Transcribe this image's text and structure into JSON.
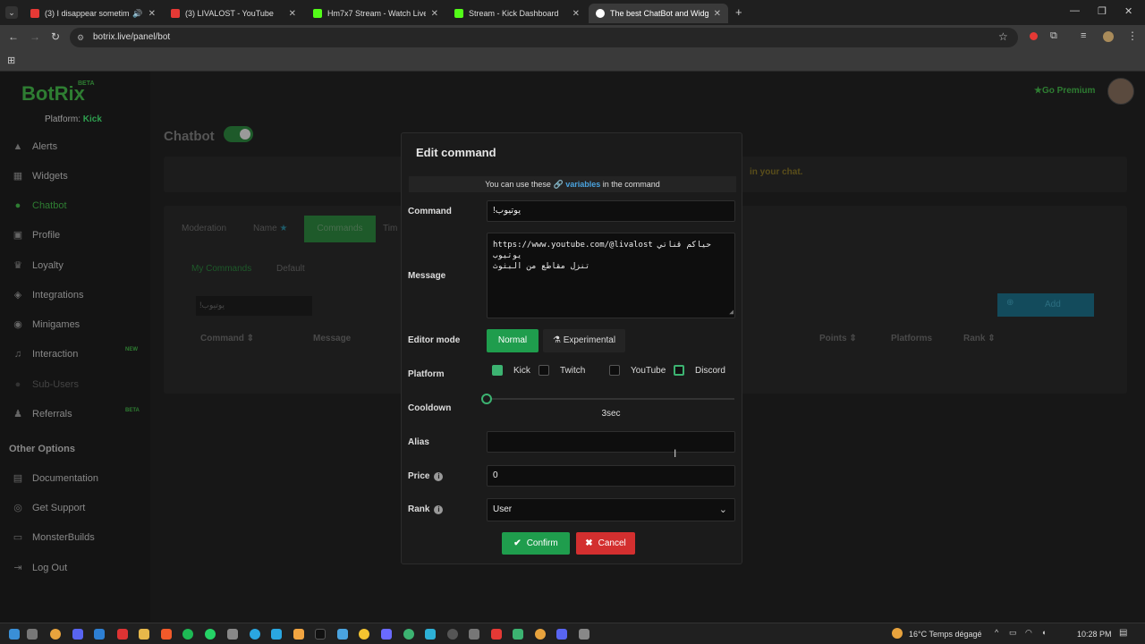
{
  "browser": {
    "tabs": [
      {
        "title": "(3) I disappear sometimes,",
        "color": "#e53935"
      },
      {
        "title": "(3) LIVALOST - YouTube",
        "color": "#e53935"
      },
      {
        "title": "Hm7x7 Stream - Watch Live on",
        "color": "#53fc18"
      },
      {
        "title": "Stream - Kick Dashboard",
        "color": "#53fc18"
      },
      {
        "title": "The best ChatBot and Widgets",
        "color": "#ffffff"
      }
    ],
    "url": "botrix.live/panel/bot"
  },
  "sidebar": {
    "logo": "BotRix",
    "beta": "BETA",
    "platform_label": "Platform:",
    "platform_value": "Kick",
    "items": [
      {
        "label": "Alerts",
        "icon": "warning-icon"
      },
      {
        "label": "Widgets",
        "icon": "grid-icon"
      },
      {
        "label": "Chatbot",
        "icon": "robot-icon"
      },
      {
        "label": "Profile",
        "icon": "profile-icon"
      },
      {
        "label": "Loyalty",
        "icon": "trophy-icon"
      },
      {
        "label": "Integrations",
        "icon": "puzzle-icon"
      },
      {
        "label": "Minigames",
        "icon": "gamepad-icon"
      },
      {
        "label": "Interaction",
        "icon": "music-icon"
      },
      {
        "label": "Sub-Users",
        "icon": "users-icon"
      },
      {
        "label": "Referrals",
        "icon": "referral-icon"
      }
    ],
    "new_tag": "NEW",
    "beta_tag": "BETA",
    "other_header": "Other Options",
    "other_items": [
      {
        "label": "Documentation",
        "icon": "book-icon"
      },
      {
        "label": "Get Support",
        "icon": "support-icon"
      },
      {
        "label": "MonsterBuilds",
        "icon": "monitor-icon"
      },
      {
        "label": "Log Out",
        "icon": "logout-icon"
      }
    ]
  },
  "header": {
    "go_premium": "Go Premium"
  },
  "background": {
    "title": "Chatbot",
    "banner_text": "in your chat.",
    "tabs": [
      "Moderation",
      "Name",
      "Commands",
      "Tim"
    ],
    "subtabs": [
      "My Commands",
      "Default"
    ],
    "search_value": "!يوتيوب",
    "add_label": "Add",
    "columns": [
      "Command",
      "Message",
      "Points",
      "Platforms",
      "Rank"
    ]
  },
  "modal": {
    "title": "Edit command",
    "info_prefix": "You can use these",
    "info_link": "variables",
    "info_suffix": "in the command",
    "command_label": "Command",
    "command_value": "!يوتيوب",
    "message_label": "Message",
    "message_line1": "https://www.youtube.com/@livalost  حياكم قناتي يوتيوب",
    "message_line2": "تنزل مقاطع من البثوث",
    "editor_label": "Editor mode",
    "editor_normal": "Normal",
    "editor_experimental": "Experimental",
    "platform_label": "Platform",
    "platforms": [
      {
        "name": "Kick",
        "checked": true
      },
      {
        "name": "Twitch",
        "checked": false
      },
      {
        "name": "YouTube",
        "checked": false
      },
      {
        "name": "Discord",
        "checked": false
      }
    ],
    "cooldown_label": "Cooldown",
    "cooldown_value": "3sec",
    "alias_label": "Alias",
    "alias_value": "",
    "price_label": "Price",
    "price_value": "0",
    "rank_label": "Rank",
    "rank_value": "User",
    "confirm_label": "Confirm",
    "cancel_label": "Cancel"
  },
  "taskbar": {
    "weather": "16°C  Temps dégagé",
    "time": "10:28 PM"
  }
}
